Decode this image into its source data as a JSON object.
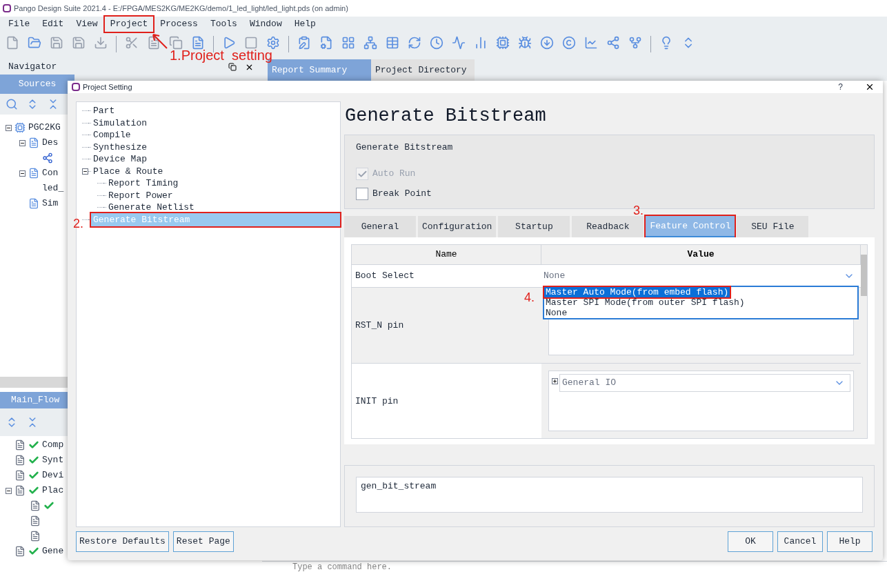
{
  "window": {
    "title": "Pango Design Suite 2021.4 - E:/FPGA/MES2KG/ME2KG/demo/1_led_light/led_light.pds (on admin)"
  },
  "menu": [
    {
      "label": "File",
      "highlighted": false
    },
    {
      "label": "Edit",
      "highlighted": false
    },
    {
      "label": "View",
      "highlighted": false
    },
    {
      "label": "Project",
      "highlighted": true
    },
    {
      "label": "Process",
      "highlighted": false
    },
    {
      "label": "Tools",
      "highlighted": false
    },
    {
      "label": "Window",
      "highlighted": false
    },
    {
      "label": "Help",
      "highlighted": false
    }
  ],
  "navigator": {
    "title": "Navigator",
    "tabs": [
      {
        "label": "Sources",
        "selected": true
      }
    ],
    "tree": [
      {
        "label": "PGC2KG",
        "kind": "chip",
        "expanded": true,
        "children": [
          {
            "label": "Des",
            "kind": "file",
            "expanded": true,
            "children": [
              {
                "kind": "link"
              }
            ]
          },
          {
            "label": "Con",
            "kind": "file",
            "expanded": true,
            "children": [
              {
                "label": "led_",
                "kind": "text"
              }
            ]
          },
          {
            "label": "Sim",
            "kind": "file"
          }
        ]
      }
    ]
  },
  "flow": {
    "title": "Main_Flow",
    "items": [
      {
        "label": "Comp",
        "done": true
      },
      {
        "label": "Synt",
        "done": true
      },
      {
        "label": "Devi",
        "done": true
      },
      {
        "label": "Plac",
        "done": true,
        "expanded": true,
        "children": [
          {
            "done": true
          },
          {
            "done": false
          },
          {
            "done": false
          }
        ]
      },
      {
        "label": "Gene",
        "done": true
      }
    ]
  },
  "editor_tabs": [
    {
      "label": "Report Summary",
      "selected": true
    },
    {
      "label": "Project Directory",
      "selected": false
    }
  ],
  "command": {
    "placeholder": "Type a command here."
  },
  "dialog": {
    "title": "Project Setting",
    "help": "?",
    "tree": [
      {
        "label": "Part",
        "selected": false
      },
      {
        "label": "Simulation",
        "selected": false
      },
      {
        "label": "Compile",
        "selected": false
      },
      {
        "label": "Synthesize",
        "selected": false
      },
      {
        "label": "Device Map",
        "selected": false
      },
      {
        "label": "Place & Route",
        "selected": false,
        "expanded": true,
        "children": [
          {
            "label": "Report Timing",
            "selected": false
          },
          {
            "label": "Report Power",
            "selected": false
          },
          {
            "label": "Generate Netlist",
            "selected": false
          }
        ]
      },
      {
        "label": "Generate Bitstream",
        "selected": true,
        "highlighted": true
      }
    ],
    "heading": "Generate Bitstream",
    "group": {
      "title": "Generate Bitstream",
      "options": [
        {
          "label": "Auto Run",
          "checked": true,
          "disabled": true
        },
        {
          "label": "Break Point",
          "checked": false,
          "disabled": false
        }
      ]
    },
    "tabs": [
      {
        "label": "General",
        "selected": false
      },
      {
        "label": "Configuration",
        "selected": false
      },
      {
        "label": "Startup",
        "selected": false
      },
      {
        "label": "Readback",
        "selected": false
      },
      {
        "label": "Feature Control",
        "selected": true,
        "highlighted": true
      },
      {
        "label": "SEU File",
        "selected": false
      }
    ],
    "table": {
      "columns": [
        "Name",
        "Value"
      ],
      "rows": [
        {
          "name": "Boot Select",
          "kind": "dropdown",
          "value": "None"
        },
        {
          "name": "RST_N pin",
          "kind": "box"
        },
        {
          "name": "INIT pin",
          "kind": "tree",
          "value": "General IO"
        }
      ]
    },
    "dropdown_list": [
      {
        "label": "Master Auto Mode(from embed flash)",
        "selected": true,
        "highlighted": true
      },
      {
        "label": "Master SPI Mode(from outer SPI flash)",
        "selected": false
      },
      {
        "label": "None",
        "selected": false
      }
    ],
    "command_text": "gen_bit_stream",
    "left_buttons": [
      "Restore Defaults",
      "Reset Page"
    ],
    "buttons": [
      "OK",
      "Cancel",
      "Help"
    ]
  },
  "annotations": [
    "1.Project  setting",
    "2.",
    "3.",
    "4."
  ]
}
